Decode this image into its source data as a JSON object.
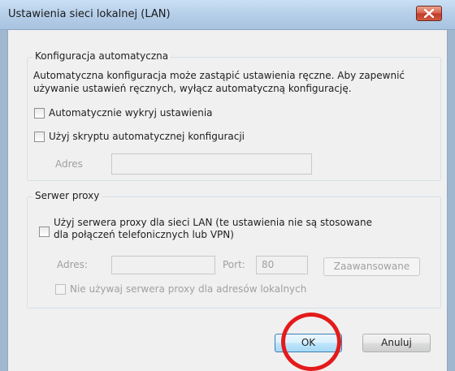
{
  "window": {
    "title": "Ustawienia sieci lokalnej (LAN)",
    "close_icon": "close-icon"
  },
  "auto_config": {
    "legend": "Konfiguracja automatyczna",
    "description_line1": "Automatyczna konfiguracja może zastąpić ustawienia ręczne. Aby zapewnić",
    "description_line2": "używanie ustawień ręcznych, wyłącz automatyczną konfigurację.",
    "auto_detect": {
      "label": "Automatycznie wykryj ustawienia",
      "checked": false
    },
    "use_script": {
      "label": "Użyj skryptu automatycznej konfiguracji",
      "checked": false
    },
    "address_label": "Adres",
    "address_value": ""
  },
  "proxy": {
    "legend": "Serwer proxy",
    "use_proxy": {
      "label_line1": "Użyj serwera proxy dla sieci LAN (te ustawienia nie są stosowane",
      "label_line2": "dla połączeń telefonicznych lub VPN)",
      "checked": false
    },
    "address_label": "Adres:",
    "address_value": "",
    "port_label": "Port:",
    "port_value": "80",
    "advanced_label": "Zaawansowane",
    "bypass_local": {
      "label": "Nie używaj serwera proxy dla adresów lokalnych",
      "checked": false
    }
  },
  "buttons": {
    "ok_label": "OK",
    "cancel_label": "Anuluj"
  },
  "highlight": {
    "color": "#e41b1b",
    "target": "ok-button"
  }
}
